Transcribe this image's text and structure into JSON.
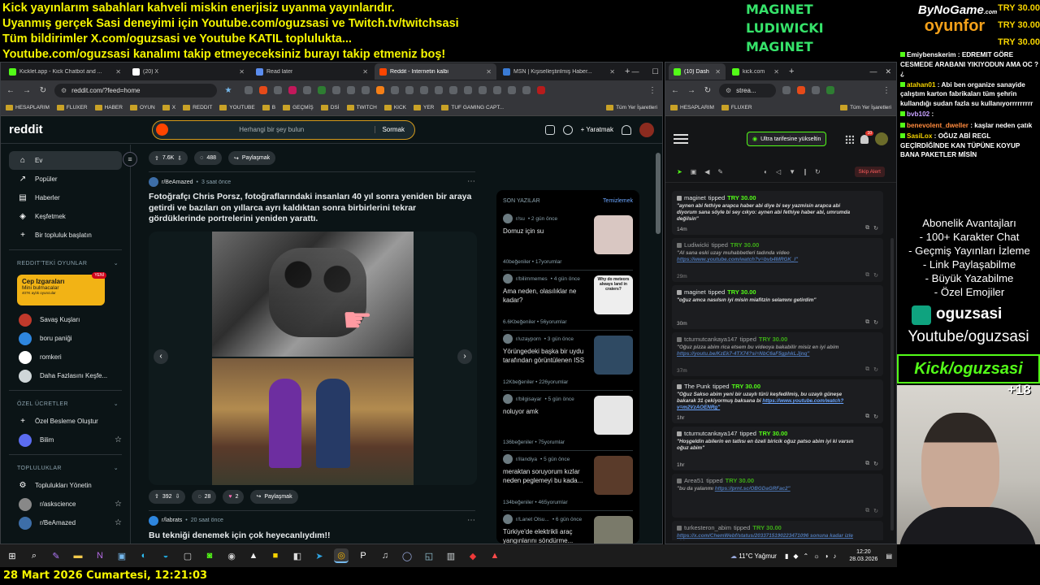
{
  "overlay": {
    "banner_lines": [
      "Kick yayınlarım sabahları kahveli miskin enerjisiz uyanma yayınlarıdır.",
      "Uyanmış gerçek Sasi deneyimi için Youtube.com/oguzsasi ve Twitch.tv/twitchsasi",
      "Tüm bildirimler X.com/oguzsasi ve Youtube KATIL toplulukta...",
      "Youtube.com/oguzsasi kanalımı takip etmeyeceksiniz burayı takip etmeniz boş!"
    ],
    "top_tippers": [
      "MAGINET",
      "LUDIWICKI",
      "MAGINET"
    ],
    "brand_top": "ByNoGame",
    "brand_small": ".com",
    "brand_bottom": "oyunfor",
    "try_values": [
      "TRY 30.00",
      "TRY 30.00",
      "TRY 30.00"
    ],
    "chat": [
      {
        "user": "Emiybenskerim",
        "text": "EDREMIT GÖRE CESMEDE ARABANI YIKIYODUN AMA OC ?¿",
        "color": "#ffffff"
      },
      {
        "user": "atahan01",
        "text": "Abi ben organize sanayide çalıştım karton fabrikaları tüm şehrin kullandığı sudan fazla su kullanıyorrrrrrrrr",
        "color": "#f5d300"
      },
      {
        "user": "bvb102",
        "text": "",
        "color": "#c8a2ff"
      },
      {
        "user": "benevolent_dweller",
        "text": "kaşlar neden çatık",
        "color": "#ff8a3d"
      },
      {
        "user": "SasiLox",
        "text": "OĞUZ ABİ REGL GEÇİRDİĞİNDE KAN TÜPÜNE KOYUP BANA PAKETLER MİSİN",
        "color": "#f5d300"
      }
    ],
    "sub_benefits": [
      "Abonelik Avantajları",
      "- 100+ Karakter Chat",
      "- Geçmiş Yayınları İzleme",
      "- Link Paylaşabilme",
      "- Büyük Yazabilme",
      "- Özel Emojiler"
    ],
    "kick_name": "oguzsasi",
    "youtube_line": "Youtube/oguzsasi",
    "kick_line": "Kick/oguzsasi",
    "age_badge": "+18",
    "datetime": "28 Mart 2026 Cumartesi, 12:21:03"
  },
  "left_browser": {
    "tabs": [
      {
        "label": "Kicklet.app - Kick Chatbot and ...",
        "color": "#53fc18",
        "active": false
      },
      {
        "label": "(20) X",
        "color": "#ffffff",
        "active": false
      },
      {
        "label": "Read later",
        "color": "#5b8def",
        "active": false
      },
      {
        "label": "Reddit - İnternetin kalbi",
        "color": "#ff4500",
        "active": true
      },
      {
        "label": "MSN | Kişiselleştirilmiş Haber...",
        "color": "#3a7bd5",
        "active": false
      }
    ],
    "url": "reddit.com/?feed=home",
    "bookmarks": [
      "HESAPLARIM",
      "FLUXER",
      "HABER",
      "OYUN",
      "X",
      "REDDIT",
      "YOUTUBE",
      "B",
      "GEÇMİŞ",
      "DSİ",
      "TWITCH",
      "KICK",
      "YER",
      "TUF GAMING CAPT...",
      "Tüm Yer İşaretleri"
    ]
  },
  "reddit": {
    "logo": "reddit",
    "search_placeholder": "Herhangi bir şey bulun",
    "ask_label": "Sormak",
    "create_label": "Yaratmak",
    "sidebar": {
      "main": [
        {
          "label": "Ev",
          "icon": "home-icon",
          "glyph": "⌂"
        },
        {
          "label": "Popüler",
          "icon": "popular-icon",
          "glyph": "↗"
        },
        {
          "label": "Haberler",
          "icon": "news-icon",
          "glyph": "▤"
        },
        {
          "label": "Keşfetmek",
          "icon": "explore-icon",
          "glyph": "◈"
        },
        {
          "label": "Bir topluluk başlatın",
          "icon": "plus-icon",
          "glyph": "+"
        }
      ],
      "games_heading": "REDDIT'TEKİ OYUNLAR",
      "promo": {
        "title": "Cep Izgaraları",
        "subtitle": "Mini bulmacalar",
        "note": "407K aylık oyuncular",
        "tag": "YENİ"
      },
      "games": [
        {
          "label": "Savaş Kuşları",
          "color": "#c0392b"
        },
        {
          "label": "boru paniği",
          "color": "#2e86de"
        },
        {
          "label": "romkeri",
          "color": "#ffffff"
        },
        {
          "label": "Daha Fazlasını Keşfe...",
          "color": "#cfd6d8"
        }
      ],
      "custom_heading": "ÖZEL ÜCRETLER",
      "custom": [
        {
          "label": "Özel Besleme Oluştur",
          "color": "",
          "glyph": "+"
        },
        {
          "label": "Bilim",
          "color": "#5b6cf0",
          "glyph": ""
        }
      ],
      "communities_heading": "TOPLULUKLAR",
      "communities": [
        {
          "label": "Toplulukları Yönetin",
          "color": "",
          "glyph": "⚙"
        },
        {
          "label": "r/askscience",
          "color": "#888888",
          "glyph": ""
        },
        {
          "label": "r/BeAmazed",
          "color": "#3d6ea8",
          "glyph": ""
        }
      ]
    },
    "top_bar_actions": {
      "votes": "7.6K",
      "comments": "488",
      "share": "Paylaşmak"
    },
    "post1": {
      "sub": "r/BeAmazed",
      "time": "3 saat önce",
      "title": "Fotoğrafçı Chris Porsz, fotoğraflarındaki insanları 40 yıl sonra yeniden bir araya getirdi ve bazıları on yıllarca ayrı kaldıktan sonra birbirlerini tekrar gördüklerinde portrelerini yeniden yarattı.",
      "votes": "392",
      "comments": "28",
      "awards": "2",
      "share": "Paylaşmak"
    },
    "post2": {
      "sub": "r/labrats",
      "time": "20 saat önce",
      "title": "Bu tekniği denemek için çok heyecanlıydım!!"
    },
    "recent": {
      "heading": "SON YAZILAR",
      "clear": "Temizlemek",
      "items": [
        {
          "sub": "r/su",
          "time": "2 gün önce",
          "title": "Domuz için su",
          "likes": "40beğeniler",
          "comments": "17yorumlar",
          "thumb": "#d9c7c2"
        },
        {
          "sub": "r/bilimmemes",
          "time": "4 gün önce",
          "title": "Ama neden, olasılıklar ne kadar?",
          "likes": "6.6Kbeğeniler",
          "comments": "56yorumlar",
          "thumb": "#eeeeee",
          "caption": "Why do meteors always land in craters?"
        },
        {
          "sub": "r/uzayporn",
          "time": "3 gün önce",
          "title": "Yörüngedeki başka bir uydu tarafından görüntülenen ISS",
          "likes": "12Kbeğeniler",
          "comments": "226yorumlar",
          "thumb": "#2f4a63"
        },
        {
          "sub": "r/bilgisayar",
          "time": "5 gün önce",
          "title": "noluyor amk",
          "likes": "136beğeniler",
          "comments": "75yorumlar",
          "thumb": "#e6e6e6"
        },
        {
          "sub": "r/ilandiya",
          "time": "5 gün önce",
          "title": "meraktan soruyorum kızlar neden peglemeyi bu kada...",
          "likes": "134beğeniler",
          "comments": "465yorumlar",
          "thumb": "#5a3b2a"
        },
        {
          "sub": "r/Lanet Olsu...",
          "time": "6 gün önce",
          "title": "Türkiye'de elektrikli araç yangınlarını söndürme...",
          "likes": "49Kbeğeniler",
          "comments": "1.4Kyorumlar",
          "thumb": "#7a7a6a",
          "duration": "0:47"
        }
      ]
    }
  },
  "right_browser": {
    "tabs": [
      {
        "label": "(10) Dash",
        "color": "#53fc18",
        "active": true
      },
      {
        "label": "kick.com",
        "color": "#53fc18",
        "active": false
      }
    ],
    "url": "strea...",
    "bookmarks": [
      "HESAPLARIM",
      "FLUXER",
      "Tüm Yer İşaretleri"
    ]
  },
  "kick": {
    "upgrade_label": "Ultra tarifesine yükseltin",
    "bell_badge": "10",
    "skip_label": "Skip Alert",
    "alerts": [
      {
        "user": "maginet",
        "amount": "TRY 30.00",
        "message": "\"aynen abi fethiye arapca haber abi diye bi sey yazmisin arapca abi diyorum sana söyle bi sey cıkyo: aynen abi fethiye haber abi, umrumda değilsin\"",
        "link": "",
        "time": "14m",
        "dim": false
      },
      {
        "user": "Ludiwicki",
        "amount": "TRY 30.00",
        "message": "\"Al sana eski uzay muhabbetleri tadında video",
        "link": "https://www.youtube.com/watch?v=bvb4MRGK_I\"",
        "time": "29m",
        "dim": true
      },
      {
        "user": "maginet",
        "amount": "TRY 30.00",
        "message": "\"oğuz amca nasılsın iyi misin miafitzin selamını getirdim\"",
        "link": "",
        "time": "30m",
        "dim": false
      },
      {
        "user": "tcturnutcankaya147",
        "amount": "TRY 30.00",
        "message": "\"Oğuz pizza abim rica etsem bu videoya bakabilir misiz en iyi abim",
        "link": "https://youtu.be/KzEk7-4TX74?si=NbC6aF5gphkLJjnq\"",
        "time": "37m",
        "dim": true
      },
      {
        "user": "The Punk",
        "amount": "TRY 30.00",
        "message": "\"Oğuz Sakso abim yeni bir uzaylı türü keşfedilmiş, bu uzaylı güneşe bakarak 31 çekiyormuş baksana bi",
        "link": "https://www.youtube.com/watch?v=m2VzAOENRg\"",
        "time": "1hr",
        "dim": false
      },
      {
        "user": "tcturnutcankaya147",
        "amount": "TRY 30.00",
        "message": "\"Hoşgeldin abilerin en tatlısı en özeli biricik oğuz patso abim iyi ki varsın oğuz abim\"",
        "link": "",
        "time": "1hr",
        "dim": false
      },
      {
        "user": "Area51",
        "amount": "TRY 30.00",
        "message": "\"bu da yalanmı",
        "link": "https://prnt.sc/OBGDaGRFac2\"",
        "time": "",
        "dim": true
      },
      {
        "user": "turkesteron_abim",
        "amount": "TRY 30.00",
        "message": "",
        "link": "https://x.com/ChemWebf/status/2033715190223471096 sonuna kadar izle abim",
        "time": "",
        "dim": true
      }
    ]
  },
  "taskbar": {
    "weather": "11°C  Yağmur",
    "time": "12:20",
    "date": "28.03.2026",
    "apps": [
      {
        "name": "start-icon",
        "glyph": "⊞",
        "color": "#ffffff"
      },
      {
        "name": "search-icon",
        "glyph": "⌕",
        "color": "#ffffff"
      },
      {
        "name": "pen-icon",
        "glyph": "✎",
        "color": "#b57cff"
      },
      {
        "name": "explorer-icon",
        "glyph": "▬",
        "color": "#f2c94c"
      },
      {
        "name": "onenote-icon",
        "glyph": "N",
        "color": "#b36ae2"
      },
      {
        "name": "window-icon",
        "glyph": "▣",
        "color": "#76b9ed"
      },
      {
        "name": "edge-icon",
        "glyph": "◐",
        "color": "#2fbff4"
      },
      {
        "name": "edge2-icon",
        "glyph": "◒",
        "color": "#1fa3d6"
      },
      {
        "name": "camera-icon",
        "glyph": "▢",
        "color": "#cccccc"
      },
      {
        "name": "xbox-icon",
        "glyph": "◙",
        "color": "#53fc18"
      },
      {
        "name": "steam-icon",
        "glyph": "◉",
        "color": "#cccccc"
      },
      {
        "name": "unity-icon",
        "glyph": "▲",
        "color": "#eeeeee"
      },
      {
        "name": "sticky-icon",
        "glyph": "■",
        "color": "#f5d300"
      },
      {
        "name": "photo-icon",
        "glyph": "◧",
        "color": "#dddddd"
      },
      {
        "name": "telegram-icon",
        "glyph": "➤",
        "color": "#2fa3e0"
      },
      {
        "name": "chrome-icon",
        "glyph": "◎",
        "color": "#f4b400",
        "selected": true
      },
      {
        "name": "p-icon",
        "glyph": "P",
        "color": "#ffffff"
      },
      {
        "name": "audio-icon",
        "glyph": "♫",
        "color": "#dddddd"
      },
      {
        "name": "obs-icon",
        "glyph": "◯",
        "color": "#9ad"
      },
      {
        "name": "note-icon",
        "glyph": "◱",
        "color": "#9cd"
      },
      {
        "name": "trello-icon",
        "glyph": "▥",
        "color": "#cfd6d8"
      },
      {
        "name": "vivaldi-icon",
        "glyph": "◆",
        "color": "#ef3939"
      },
      {
        "name": "streamer-icon",
        "glyph": "▲",
        "color": "#ff4b4b"
      }
    ]
  }
}
